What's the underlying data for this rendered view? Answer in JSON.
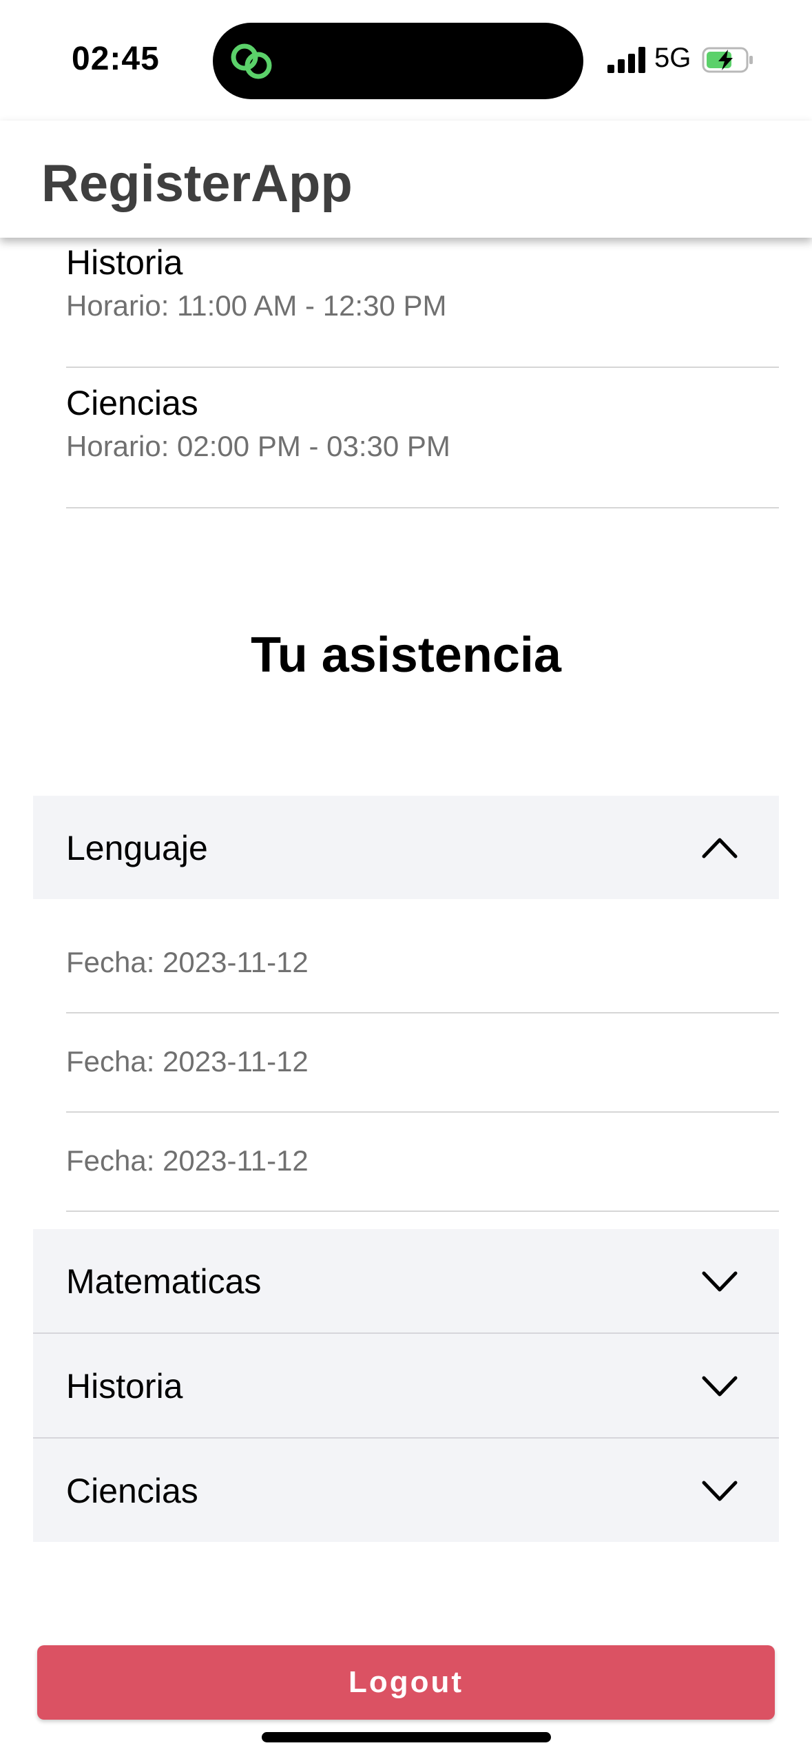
{
  "status_bar": {
    "time": "02:45",
    "network": "5G",
    "island_icon": "link-icon",
    "battery_state": "charging",
    "accent_color": "#5bd16a"
  },
  "header": {
    "title": "RegisterApp"
  },
  "schedule": [
    {
      "subject": "Historia",
      "hours": "Horario: 11:00 AM - 12:30 PM"
    },
    {
      "subject": "Ciencias",
      "hours": "Horario: 02:00 PM - 03:30 PM"
    }
  ],
  "attendance": {
    "title": "Tu asistencia",
    "sections": [
      {
        "label": "Lenguaje",
        "expanded": true,
        "records": [
          "Fecha: 2023-11-12",
          "Fecha: 2023-11-12",
          "Fecha: 2023-11-12"
        ]
      },
      {
        "label": "Matematicas",
        "expanded": false
      },
      {
        "label": "Historia",
        "expanded": false
      },
      {
        "label": "Ciencias",
        "expanded": false
      }
    ]
  },
  "logout": {
    "label": "Logout",
    "color": "#db5263"
  }
}
